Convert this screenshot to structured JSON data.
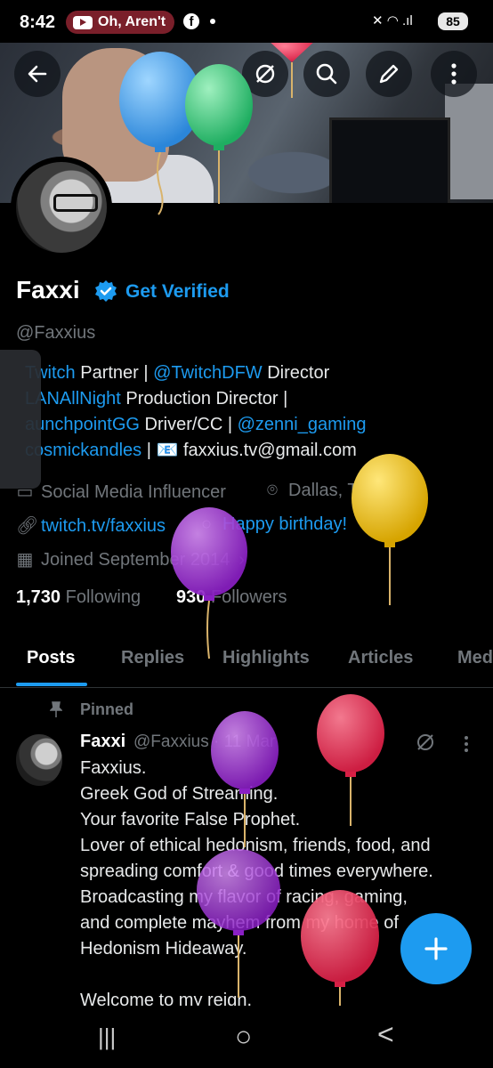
{
  "status_bar": {
    "time": "8:42",
    "notification_pill": "Oh, Aren't",
    "battery": "85",
    "signal_icons": "✕ ◠ .ıl"
  },
  "header": {
    "back_icon": "arrow-left-icon",
    "grok_icon": "grok-icon",
    "search_icon": "search-icon",
    "edit_icon": "pencil-icon",
    "more_icon": "more-vertical-icon"
  },
  "profile": {
    "name": "Faxxi",
    "get_verified": "Get Verified",
    "handle": "@Faxxius",
    "bio_lines": [
      {
        "parts": [
          {
            "t": "Twitch",
            "link": true
          },
          {
            "t": " Partner | ",
            "link": false
          },
          {
            "t": "@TwitchDFW",
            "link": true
          },
          {
            "t": " Director",
            "link": false
          }
        ]
      },
      {
        "parts": [
          {
            "t": "LANAllNight",
            "link": true
          },
          {
            "t": " Production Director |",
            "link": false
          }
        ]
      },
      {
        "parts": [
          {
            "t": "aunchpointGG",
            "link": true
          },
          {
            "t": " Driver/CC | ",
            "link": false
          },
          {
            "t": "@zenni_gaming",
            "link": true
          }
        ]
      },
      {
        "parts": [
          {
            "t": "cosmickandles",
            "link": true
          },
          {
            "t": " | 📧 faxxius.tv@gmail.com",
            "link": false
          }
        ]
      }
    ],
    "category": "Social Media Influencer",
    "location": "Dallas, TX",
    "website": "twitch.tv/faxxius",
    "birthday": "Happy birthday!",
    "joined": "Joined September 2014",
    "following_count": "1,730",
    "following_label": "Following",
    "followers_count": "930",
    "followers_label": "Followers"
  },
  "tabs": [
    "Posts",
    "Replies",
    "Highlights",
    "Articles",
    "Med"
  ],
  "post": {
    "pinned_label": "Pinned",
    "author": "Faxxi",
    "meta": "@Faxxius · 11 Mar",
    "text": "Faxxius.\nGreek God of Streaming.\nYour favorite False Prophet.\nLover of ethical hedonism, friends, food, and\nspreading comfort & good times everywhere.\nBroadcasting my flavor of racing, gaming,\nand complete mayhem from my home of\nHedonism Hideaway.\n\nWelcome to my reign."
  },
  "fab_icon": "plus-icon",
  "navbar": {
    "recents": "|||",
    "home": "○",
    "back": "<"
  },
  "colors": {
    "accent": "#1d9bf0",
    "background": "#000000",
    "muted": "#71767b"
  }
}
